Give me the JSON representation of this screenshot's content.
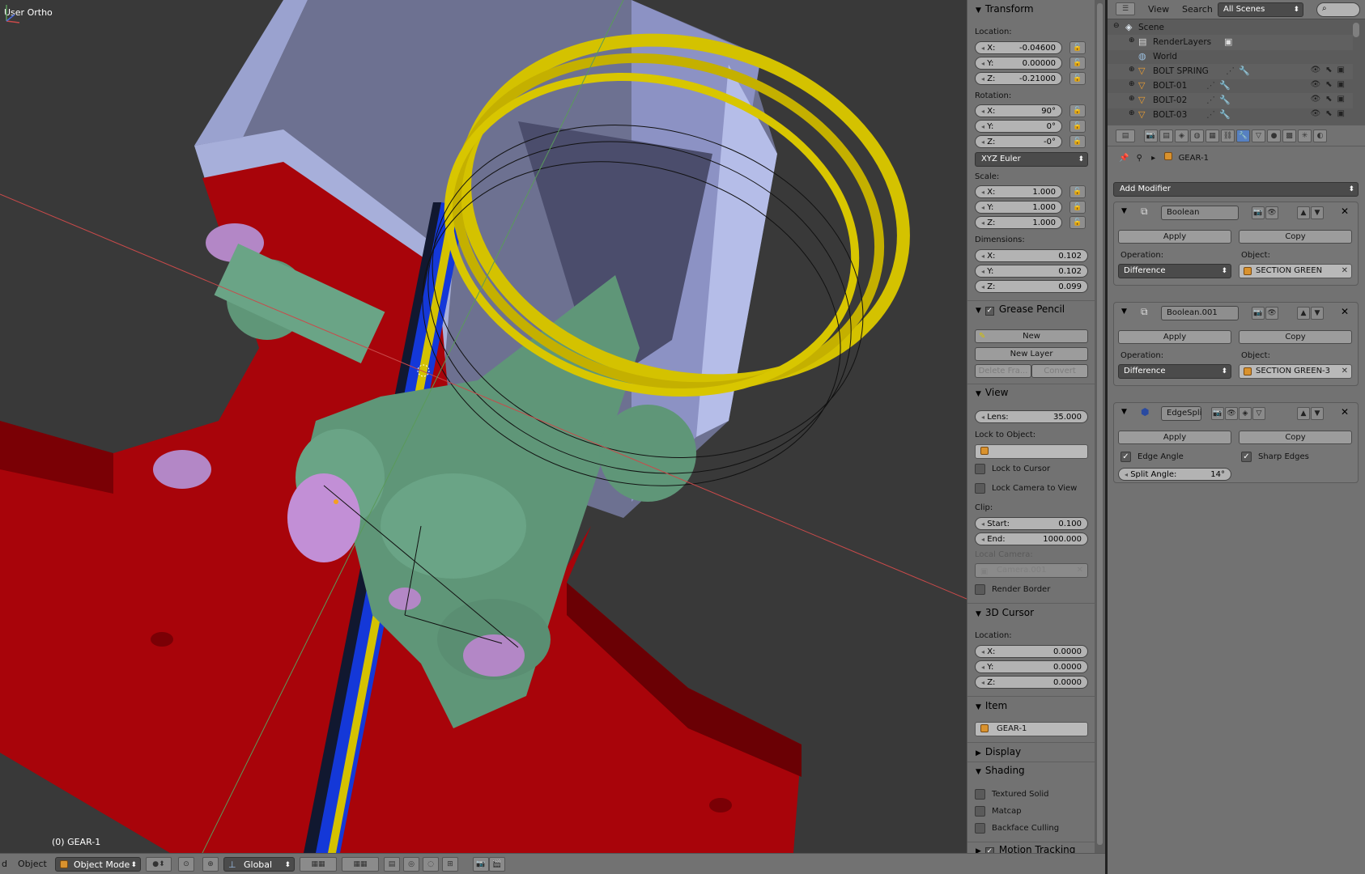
{
  "viewport": {
    "title": "User Ortho",
    "active_object": "(0) GEAR-1",
    "header": {
      "menu_view": "d",
      "menu_object": "Object",
      "mode": "Object Mode",
      "orientation": "Global"
    }
  },
  "npanel": {
    "transform": {
      "title": "Transform",
      "location_label": "Location:",
      "location": {
        "x": "-0.04600",
        "y": "0.00000",
        "z": "-0.21000"
      },
      "rotation_label": "Rotation:",
      "rotation": {
        "x": "90°",
        "y": "0°",
        "z": "-0°"
      },
      "rotation_mode": "XYZ Euler",
      "scale_label": "Scale:",
      "scale": {
        "x": "1.000",
        "y": "1.000",
        "z": "1.000"
      },
      "dimensions_label": "Dimensions:",
      "dimensions": {
        "x": "0.102",
        "y": "0.102",
        "z": "0.099"
      },
      "x_label": "X:",
      "y_label": "Y:",
      "z_label": "Z:"
    },
    "grease_pencil": {
      "title": "Grease Pencil",
      "new_label": "New",
      "new_layer_label": "New Layer",
      "delete_frame_label": "Delete Fra...",
      "convert_label": "Convert"
    },
    "view": {
      "title": "View",
      "lens_label": "Lens:",
      "lens_value": "35.000",
      "lock_to_object_label": "Lock to Object:",
      "lock_to_cursor": "Lock to Cursor",
      "lock_camera_to_view": "Lock Camera to View",
      "clip_label": "Clip:",
      "clip_start_label": "Start:",
      "clip_start": "0.100",
      "clip_end_label": "End:",
      "clip_end": "1000.000",
      "local_camera_label": "Local Camera:",
      "local_camera": "Camera.001",
      "render_border": "Render Border"
    },
    "cursor": {
      "title": "3D Cursor",
      "location_label": "Location:",
      "x": "0.0000",
      "y": "0.0000",
      "z": "0.0000"
    },
    "item": {
      "title": "Item",
      "name": "GEAR-1"
    },
    "display": {
      "title": "Display"
    },
    "shading": {
      "title": "Shading",
      "textured_solid": "Textured Solid",
      "matcap": "Matcap",
      "backface_culling": "Backface Culling"
    },
    "motion_tracking": {
      "title": "Motion Tracking"
    }
  },
  "outliner": {
    "menu_view": "View",
    "menu_search": "Search",
    "scene_filter": "All Scenes",
    "rows": [
      {
        "name": "Scene"
      },
      {
        "name": "RenderLayers"
      },
      {
        "name": "World"
      },
      {
        "name": "BOLT SPRING"
      },
      {
        "name": "BOLT-01"
      },
      {
        "name": "BOLT-02"
      },
      {
        "name": "BOLT-03"
      }
    ]
  },
  "properties": {
    "breadcrumb_object": "GEAR-1",
    "add_modifier": "Add Modifier",
    "apply_label": "Apply",
    "copy_label": "Copy",
    "operation_label": "Operation:",
    "object_label": "Object:",
    "modifiers": [
      {
        "name": "Boolean",
        "operation": "Difference",
        "object": "SECTION GREEN"
      },
      {
        "name": "Boolean.001",
        "operation": "Difference",
        "object": "SECTION GREEN-3"
      },
      {
        "name": "EdgeSpli"
      }
    ],
    "edge_split": {
      "edge_angle": "Edge Angle",
      "sharp_edges": "Sharp Edges",
      "split_angle_label": "Split Angle:",
      "split_angle": "14°"
    }
  },
  "colors": {
    "viewport_bg": "#393939",
    "panel_bg": "#727272",
    "red_plate": "#a8040a",
    "green_part": "#5f9678",
    "yellow_spring": "#d4c200",
    "blue_rod": "#1438d8",
    "lavender_block": "#a9b0dc",
    "active_tab": "#5680c2"
  }
}
